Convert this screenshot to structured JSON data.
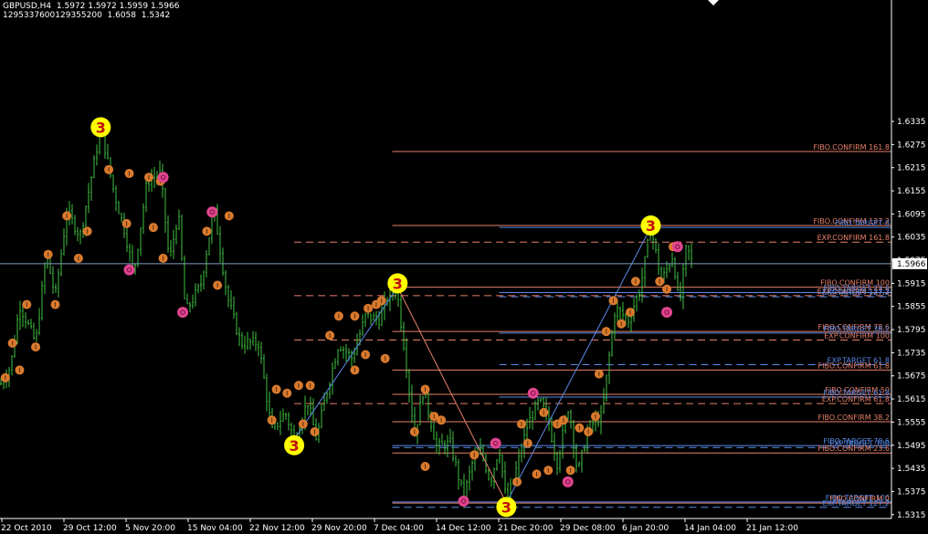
{
  "header": {
    "symbol_line": "GBPUSD,H4  1.5972 1.5972 1.5959 1.5966",
    "indicator_line": "1295337600129355200  1.6058  1.5342"
  },
  "chart_data": {
    "type": "candlestick",
    "symbol": "GBPUSD",
    "timeframe": "H4",
    "ohlc_readout": {
      "open": 1.5972,
      "high": 1.5972,
      "low": 1.5959,
      "close": 1.5966
    },
    "ylim": [
      1.5305,
      1.665
    ],
    "xlim": [
      0,
      1
    ],
    "colors": {
      "background": "#000000",
      "bars": "#3fbf3f",
      "axis": "#ffffff",
      "bid_line": "#7f9fbf",
      "confirm": "#e8806a",
      "target": "#5a8ae8",
      "wave_marker": "#ffff00",
      "small_marker": "#d97a2e",
      "pivot_marker": "#e0458f"
    },
    "y_ticks": [
      "1.6335",
      "1.6275",
      "1.6215",
      "1.6155",
      "1.6095",
      "1.6035",
      "1.5975",
      "1.5915",
      "1.5855",
      "1.5795",
      "1.5735",
      "1.5675",
      "1.5615",
      "1.5555",
      "1.5495",
      "1.5435",
      "1.5375",
      "1.5315"
    ],
    "current_price": "1.5966",
    "x_ticks": [
      "22 Oct 2010",
      "29 Oct 12:00",
      "5 Nov 20:00",
      "15 Nov 04:00",
      "22 Nov 12:00",
      "29 Nov 20:00",
      "7 Dec 04:00",
      "14 Dec 12:00",
      "21 Dec 20:00",
      "29 Dec 08:00",
      "6 Jan 20:00",
      "14 Jan 04:00",
      "21 Jan 12:00"
    ],
    "levels": [
      {
        "label": "FIBO.CONFIRM  161.8",
        "price": 1.6257,
        "color": "#e8806a",
        "dash": false,
        "start": 0.44
      },
      {
        "label": "FIBO.CONFIRM  137.2",
        "price": 1.6065,
        "color": "#e8806a",
        "dash": false,
        "start": 0.44
      },
      {
        "label": "FIBO.TARGET  0",
        "price": 1.606,
        "color": "#5a8ae8",
        "dash": false,
        "start": 0.56
      },
      {
        "label": "EXP.CONFIRM  161.8",
        "price": 1.6022,
        "color": "#e8806a",
        "dash": true,
        "start": 0.33
      },
      {
        "label": "FIBO.CONFIRM  100",
        "price": 1.5905,
        "color": "#e8806a",
        "dash": false,
        "start": 0.44
      },
      {
        "label": "FIBO.TARGET  23.6",
        "price": 1.5891,
        "color": "#5a8ae8",
        "dash": false,
        "start": 0.56
      },
      {
        "label": "EXP.CONFIRM  127.2",
        "price": 1.5883,
        "color": "#e8806a",
        "dash": true,
        "start": 0.33
      },
      {
        "label": "EXP.TARGET  127.2",
        "price": 1.588,
        "color": "#5a8ae8",
        "dash": true,
        "start": 0.56
      },
      {
        "label": "FIBO.CONFIRM  78.6",
        "price": 1.579,
        "color": "#e8806a",
        "dash": false,
        "start": 0.44
      },
      {
        "label": "FIBO.TARGET  38.2",
        "price": 1.5786,
        "color": "#5a8ae8",
        "dash": false,
        "start": 0.56
      },
      {
        "label": "EXP.CONFIRM  100",
        "price": 1.5768,
        "color": "#e8806a",
        "dash": true,
        "start": 0.33
      },
      {
        "label": "EXP.TARGET  61.8",
        "price": 1.5704,
        "color": "#5a8ae8",
        "dash": true,
        "start": 0.56
      },
      {
        "label": "FIBO.CONFIRM  61.8",
        "price": 1.569,
        "color": "#e8806a",
        "dash": false,
        "start": 0.44
      },
      {
        "label": "FIBO.CONFIRM  50",
        "price": 1.5627,
        "color": "#e8806a",
        "dash": false,
        "start": 0.44
      },
      {
        "label": "FIBO.TARGET  61.8",
        "price": 1.562,
        "color": "#5a8ae8",
        "dash": false,
        "start": 0.56
      },
      {
        "label": "EXP.CONFIRM  61.8",
        "price": 1.5603,
        "color": "#e8806a",
        "dash": true,
        "start": 0.33
      },
      {
        "label": "FIBO.CONFIRM  38.2",
        "price": 1.5556,
        "color": "#e8806a",
        "dash": false,
        "start": 0.44
      },
      {
        "label": "FIBO.TARGET  78.6",
        "price": 1.5494,
        "color": "#5a8ae8",
        "dash": false,
        "start": 0.44
      },
      {
        "label": "EXP.TARGET  100",
        "price": 1.5489,
        "color": "#5a8ae8",
        "dash": true,
        "start": 0.44
      },
      {
        "label": "FIBO.CONFIRM  23.6",
        "price": 1.5475,
        "color": "#e8806a",
        "dash": false,
        "start": 0.44
      },
      {
        "label": "FIBO.TARGET  100",
        "price": 1.5348,
        "color": "#5a8ae8",
        "dash": false,
        "start": 0.44
      },
      {
        "label": "FIBO.CONFIRM  0",
        "price": 1.5345,
        "color": "#e8806a",
        "dash": false,
        "start": 0.44
      },
      {
        "label": "EXP.TARGET  127.2",
        "price": 1.5334,
        "color": "#5a8ae8",
        "dash": true,
        "start": 0.44
      }
    ],
    "price_path": [
      [
        0.0,
        1.565
      ],
      [
        0.012,
        1.57
      ],
      [
        0.022,
        1.586
      ],
      [
        0.04,
        1.576
      ],
      [
        0.052,
        1.599
      ],
      [
        0.062,
        1.588
      ],
      [
        0.075,
        1.61
      ],
      [
        0.09,
        1.604
      ],
      [
        0.1,
        1.616
      ],
      [
        0.113,
        1.632
      ],
      [
        0.128,
        1.615
      ],
      [
        0.14,
        1.605
      ],
      [
        0.15,
        1.594
      ],
      [
        0.165,
        1.618
      ],
      [
        0.18,
        1.62
      ],
      [
        0.19,
        1.597
      ],
      [
        0.2,
        1.61
      ],
      [
        0.208,
        1.584
      ],
      [
        0.225,
        1.591
      ],
      [
        0.24,
        1.611
      ],
      [
        0.255,
        1.588
      ],
      [
        0.27,
        1.576
      ],
      [
        0.29,
        1.576
      ],
      [
        0.305,
        1.553
      ],
      [
        0.32,
        1.558
      ],
      [
        0.33,
        1.551
      ],
      [
        0.345,
        1.561
      ],
      [
        0.355,
        1.551
      ],
      [
        0.365,
        1.562
      ],
      [
        0.38,
        1.576
      ],
      [
        0.395,
        1.572
      ],
      [
        0.41,
        1.583
      ],
      [
        0.425,
        1.582
      ],
      [
        0.437,
        1.589
      ],
      [
        0.445,
        1.59
      ],
      [
        0.455,
        1.572
      ],
      [
        0.465,
        1.552
      ],
      [
        0.475,
        1.564
      ],
      [
        0.49,
        1.549
      ],
      [
        0.505,
        1.55
      ],
      [
        0.52,
        1.536
      ],
      [
        0.53,
        1.545
      ],
      [
        0.54,
        1.548
      ],
      [
        0.55,
        1.54
      ],
      [
        0.56,
        1.549
      ],
      [
        0.568,
        1.5345
      ],
      [
        0.58,
        1.544
      ],
      [
        0.592,
        1.555
      ],
      [
        0.605,
        1.561
      ],
      [
        0.615,
        1.556
      ],
      [
        0.625,
        1.545
      ],
      [
        0.638,
        1.56
      ],
      [
        0.648,
        1.542
      ],
      [
        0.66,
        1.554
      ],
      [
        0.675,
        1.557
      ],
      [
        0.69,
        1.585
      ],
      [
        0.705,
        1.582
      ],
      [
        0.718,
        1.59
      ],
      [
        0.73,
        1.606
      ],
      [
        0.742,
        1.592
      ],
      [
        0.755,
        1.599
      ],
      [
        0.762,
        1.585
      ],
      [
        0.77,
        1.601
      ],
      [
        0.777,
        1.5966
      ]
    ],
    "zigzag": [
      {
        "from": [
          0.33,
          1.551
        ],
        "to": [
          0.446,
          1.5905
        ],
        "color": "#5a8ae8"
      },
      {
        "from": [
          0.446,
          1.5905
        ],
        "to": [
          0.568,
          1.5345
        ],
        "color": "#e8806a"
      },
      {
        "from": [
          0.568,
          1.5345
        ],
        "to": [
          0.73,
          1.606
        ],
        "color": "#5a8ae8"
      }
    ],
    "wave_markers": [
      {
        "label": "3",
        "x": 0.113,
        "y": 1.632
      },
      {
        "label": "3",
        "x": 0.33,
        "y": 1.5495
      },
      {
        "label": "3",
        "x": 0.446,
        "y": 1.5915
      },
      {
        "label": "3",
        "x": 0.568,
        "y": 1.5335
      },
      {
        "label": "3",
        "x": 0.73,
        "y": 1.6065
      }
    ],
    "small_markers": [
      [
        0.006,
        1.567
      ],
      [
        0.014,
        1.576
      ],
      [
        0.022,
        1.569
      ],
      [
        0.04,
        1.575
      ],
      [
        0.03,
        1.586
      ],
      [
        0.054,
        1.599
      ],
      [
        0.062,
        1.586
      ],
      [
        0.075,
        1.609
      ],
      [
        0.088,
        1.598
      ],
      [
        0.098,
        1.605
      ],
      [
        0.122,
        1.621
      ],
      [
        0.145,
        1.62
      ],
      [
        0.142,
        1.607
      ],
      [
        0.167,
        1.619
      ],
      [
        0.172,
        1.606
      ],
      [
        0.18,
        1.618
      ],
      [
        0.183,
        1.598
      ],
      [
        0.232,
        1.605
      ],
      [
        0.244,
        1.591
      ],
      [
        0.257,
        1.609
      ],
      [
        0.31,
        1.564
      ],
      [
        0.305,
        1.556
      ],
      [
        0.322,
        1.563
      ],
      [
        0.335,
        1.565
      ],
      [
        0.348,
        1.565
      ],
      [
        0.34,
        1.555
      ],
      [
        0.353,
        1.553
      ],
      [
        0.37,
        1.578
      ],
      [
        0.38,
        1.583
      ],
      [
        0.398,
        1.583
      ],
      [
        0.413,
        1.585
      ],
      [
        0.422,
        1.586
      ],
      [
        0.428,
        1.587
      ],
      [
        0.41,
        1.573
      ],
      [
        0.398,
        1.569
      ],
      [
        0.432,
        1.572
      ],
      [
        0.477,
        1.564
      ],
      [
        0.465,
        1.553
      ],
      [
        0.487,
        1.557
      ],
      [
        0.495,
        1.556
      ],
      [
        0.477,
        1.544
      ],
      [
        0.532,
        1.547
      ],
      [
        0.58,
        1.54
      ],
      [
        0.585,
        1.555
      ],
      [
        0.592,
        1.55
      ],
      [
        0.602,
        1.542
      ],
      [
        0.61,
        1.558
      ],
      [
        0.625,
        1.555
      ],
      [
        0.615,
        1.543
      ],
      [
        0.632,
        1.556
      ],
      [
        0.64,
        1.543
      ],
      [
        0.65,
        1.554
      ],
      [
        0.66,
        1.553
      ],
      [
        0.668,
        1.557
      ],
      [
        0.672,
        1.568
      ],
      [
        0.68,
        1.579
      ],
      [
        0.688,
        1.587
      ],
      [
        0.697,
        1.581
      ],
      [
        0.707,
        1.584
      ],
      [
        0.713,
        1.592
      ],
      [
        0.74,
        1.592
      ],
      [
        0.748,
        1.59
      ],
      [
        0.755,
        1.601
      ]
    ],
    "pivot_markers": [
      [
        0.145,
        1.595
      ],
      [
        0.183,
        1.619
      ],
      [
        0.238,
        1.61
      ],
      [
        0.205,
        1.584
      ],
      [
        0.52,
        1.535
      ],
      [
        0.556,
        1.55
      ],
      [
        0.598,
        1.563
      ],
      [
        0.637,
        1.54
      ],
      [
        0.748,
        1.584
      ],
      [
        0.76,
        1.601
      ]
    ]
  }
}
